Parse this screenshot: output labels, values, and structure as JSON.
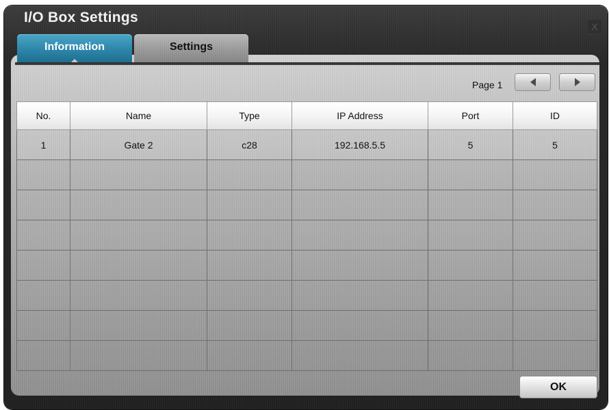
{
  "window": {
    "title": "I/O Box Settings",
    "close_label": "X"
  },
  "tabs": [
    {
      "label": "Information",
      "active": true
    },
    {
      "label": "Settings",
      "active": false
    }
  ],
  "pagination": {
    "page_label": "Page 1",
    "prev_icon": "triangle-left-icon",
    "next_icon": "triangle-right-icon"
  },
  "table": {
    "columns": [
      "No.",
      "Name",
      "Type",
      "IP Address",
      "Port",
      "ID"
    ],
    "rows": [
      [
        "1",
        "Gate 2",
        "c28",
        "192.168.5.5",
        "5",
        "5"
      ],
      [
        "",
        "",
        "",
        "",
        "",
        ""
      ],
      [
        "",
        "",
        "",
        "",
        "",
        ""
      ],
      [
        "",
        "",
        "",
        "",
        "",
        ""
      ],
      [
        "",
        "",
        "",
        "",
        "",
        ""
      ],
      [
        "",
        "",
        "",
        "",
        "",
        ""
      ],
      [
        "",
        "",
        "",
        "",
        "",
        ""
      ],
      [
        "",
        "",
        "",
        "",
        "",
        ""
      ]
    ]
  },
  "footer": {
    "ok_label": "OK"
  },
  "colors": {
    "active_tab": "#2d86a9",
    "dialog_background": "#262626",
    "content_background": "#b4b4b4"
  }
}
